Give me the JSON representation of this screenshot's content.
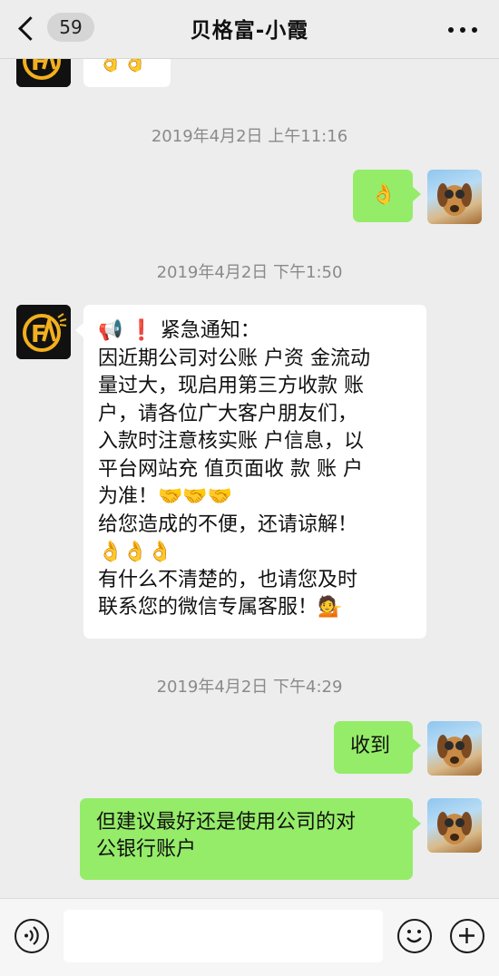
{
  "header": {
    "unread_count": "59",
    "title": "贝格富-小霞"
  },
  "messages": {
    "m0_partial": "👌👌",
    "ts1": "2019年4月2日 上午11:16",
    "m1": "👌",
    "ts2": "2019年4月2日 下午1:50",
    "m2_lines": [
      "📢 ❗ 紧急通知：",
      "因近期公司对公账 户资 金流动",
      "量过大，现启用第三方收款 账",
      "户，请各位广大客户朋友们，",
      "入款时注意核实账 户信息，以",
      "平台网站充 值页面收 款 账 户",
      "为准！🤝🤝🤝",
      "给您造成的不便，还请谅解！",
      "👌👌👌",
      "有什么不清楚的，也请您及时",
      "联系您的微信专属客服！💁"
    ],
    "ts3": "2019年4月2日 下午4:29",
    "m3": "收到",
    "m4_lines": [
      "但建议最好还是使用公司的对",
      "公银行账户"
    ]
  },
  "icons": {
    "contact_avatar": "company-logo-avatar",
    "self_avatar": "dog-photo-avatar",
    "back": "chevron-left-icon",
    "more": "more-dots-icon",
    "voice": "voice-icon",
    "emoji": "emoji-icon",
    "plus": "plus-icon"
  },
  "colors": {
    "background": "#ededed",
    "bubble_self": "#95ec69",
    "bubble_other": "#ffffff",
    "logo_gold": "#f2b01e"
  }
}
